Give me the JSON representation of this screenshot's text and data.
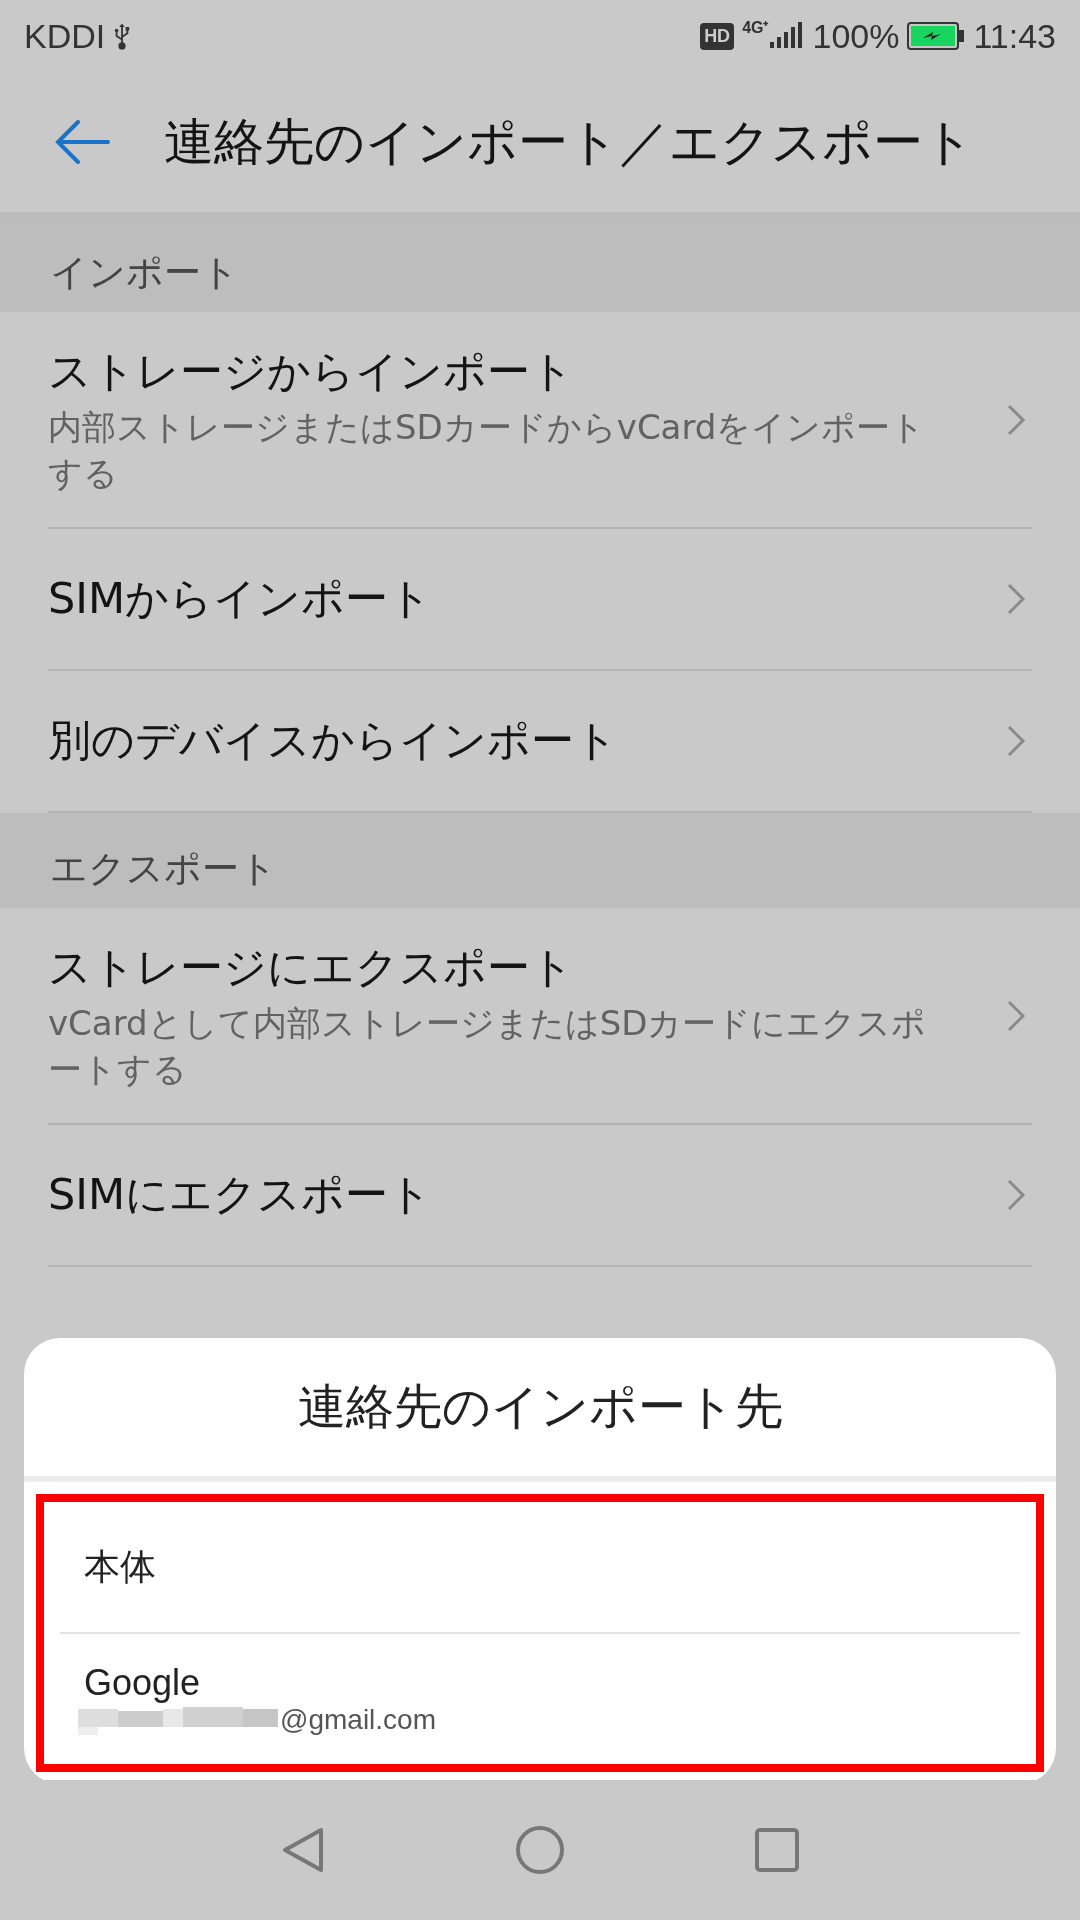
{
  "status_bar": {
    "carrier": "KDDI",
    "usb": true,
    "hd": "HD",
    "network": "4G⁺",
    "battery_text": "100%",
    "time": "11:43"
  },
  "header": {
    "title": "連絡先のインポート／エクスポート"
  },
  "sections": [
    {
      "title": "インポート",
      "items": [
        {
          "title": "ストレージからインポート",
          "subtitle": "内部ストレージまたはSDカードからvCardをインポートする"
        },
        {
          "title": "SIMからインポート"
        },
        {
          "title": "別のデバイスからインポート"
        }
      ]
    },
    {
      "title": "エクスポート",
      "items": [
        {
          "title": "ストレージにエクスポート",
          "subtitle": "vCardとして内部ストレージまたはSDカードにエクスポートする"
        },
        {
          "title": "SIMにエクスポート"
        }
      ]
    }
  ],
  "dialog": {
    "title": "連絡先のインポート先",
    "highlighted": true,
    "options": [
      {
        "label": "本体"
      },
      {
        "label": "Google",
        "account": "@gmail.com",
        "redacted": true
      }
    ]
  }
}
